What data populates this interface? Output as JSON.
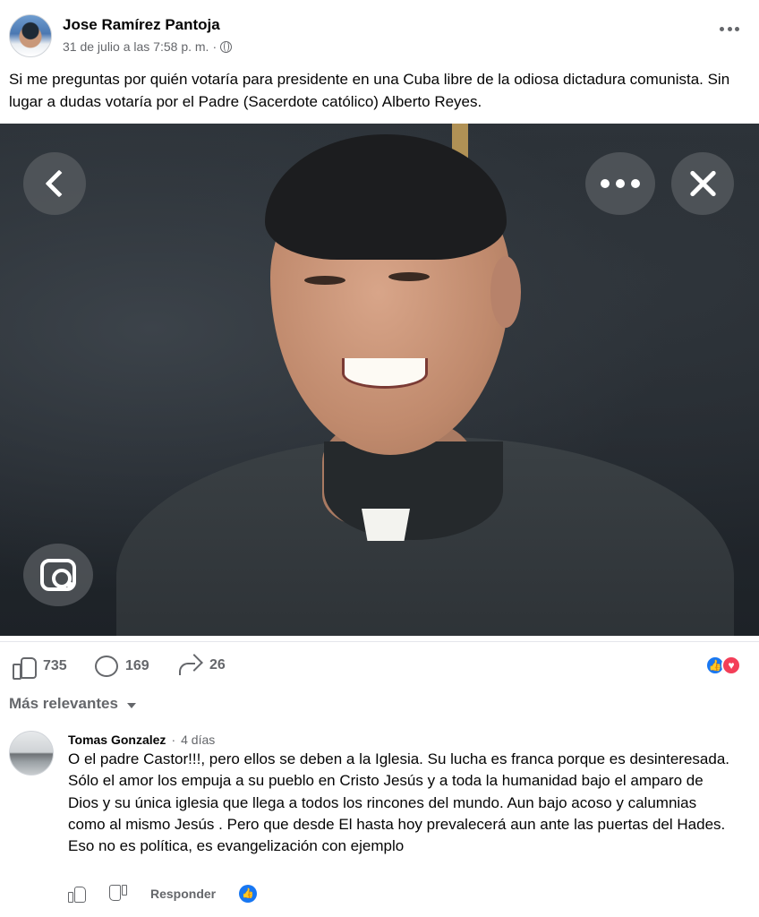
{
  "post": {
    "author": "Jose Ramírez Pantoja",
    "timestamp": "31 de julio a las 7:58 p. m.",
    "meta_separator": "·",
    "privacy_icon": "globe-icon",
    "more_icon": "more-options-icon",
    "text": "Si me preguntas por quién votaría para presidente en una Cuba libre de la odiosa dictadura comunista. Sin lugar a dudas votaría por el Padre (Sacerdote católico) Alberto Reyes."
  },
  "photo": {
    "description_icons": [
      "back-icon",
      "options-icon",
      "close-icon",
      "lens-icon"
    ]
  },
  "actions": {
    "likes": "735",
    "comments": "169",
    "shares": "26",
    "reaction_colors": {
      "like": "#1877f2",
      "love": "#f33e58"
    }
  },
  "comments_section": {
    "sort_label": "Más relevantes"
  },
  "comment": {
    "author": "Tomas Gonzalez",
    "separator": "·",
    "time": "4 días",
    "text": "O el padre Castor!!!, pero ellos se deben a la Iglesia. Su lucha es franca porque es desinteresada. Sólo el amor los empuja a su pueblo en Cristo Jesús y a toda la humanidad bajo el amparo de Dios y su única iglesia que llega a todos los rincones del mundo. Aun bajo acoso y calumnias como al mismo Jesús . Pero que desde El hasta hoy prevalecerá aun ante las puertas del Hades. Eso no es política, es evangelización con ejemplo",
    "reply_label": "Responder"
  },
  "colors": {
    "text_primary": "#050505",
    "text_secondary": "#65676b",
    "accent": "#1877f2"
  }
}
